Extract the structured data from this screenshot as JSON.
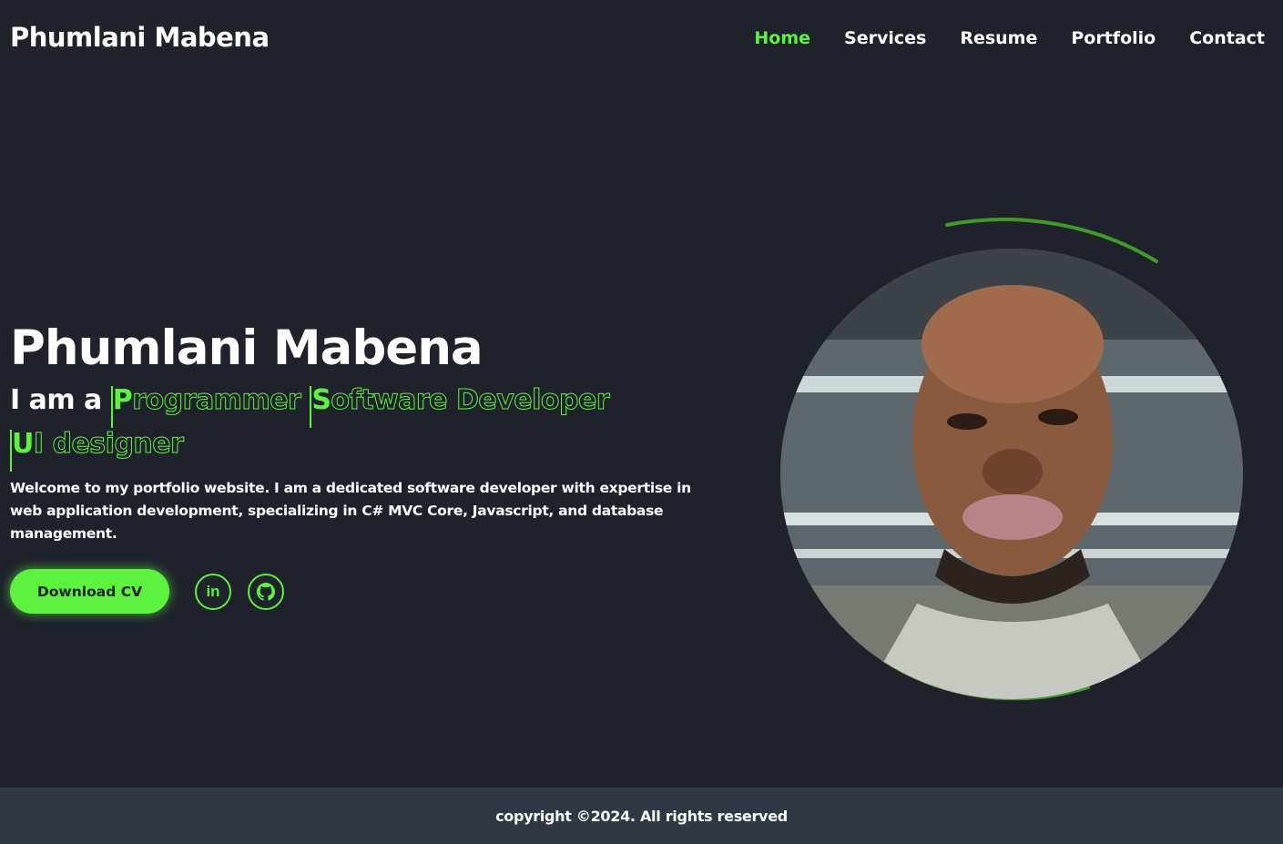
{
  "header": {
    "logo": "Phumlani Mabena",
    "nav": [
      "Home",
      "Services",
      "Resume",
      "Portfolio",
      "Contact"
    ]
  },
  "hero": {
    "name": "Phumlani Mabena",
    "lead": "I am a",
    "roles": [
      "Programmer",
      "Software Developer",
      "UI designer"
    ],
    "description": "Welcome to my portfolio website. I am a dedicated software developer with expertise in web application development, specializing in C# MVC Core, Javascript, and database management.",
    "cv_button": "Download CV",
    "socials": [
      {
        "icon": "linkedin-icon",
        "glyph": "in"
      },
      {
        "icon": "github-icon"
      }
    ],
    "portrait": "profile-photo"
  },
  "footer": {
    "copyright": "copyright ©2024. All rights reserved"
  },
  "colors": {
    "background": "#1f222b",
    "accent": "#5df23f",
    "footer": "#323745"
  }
}
